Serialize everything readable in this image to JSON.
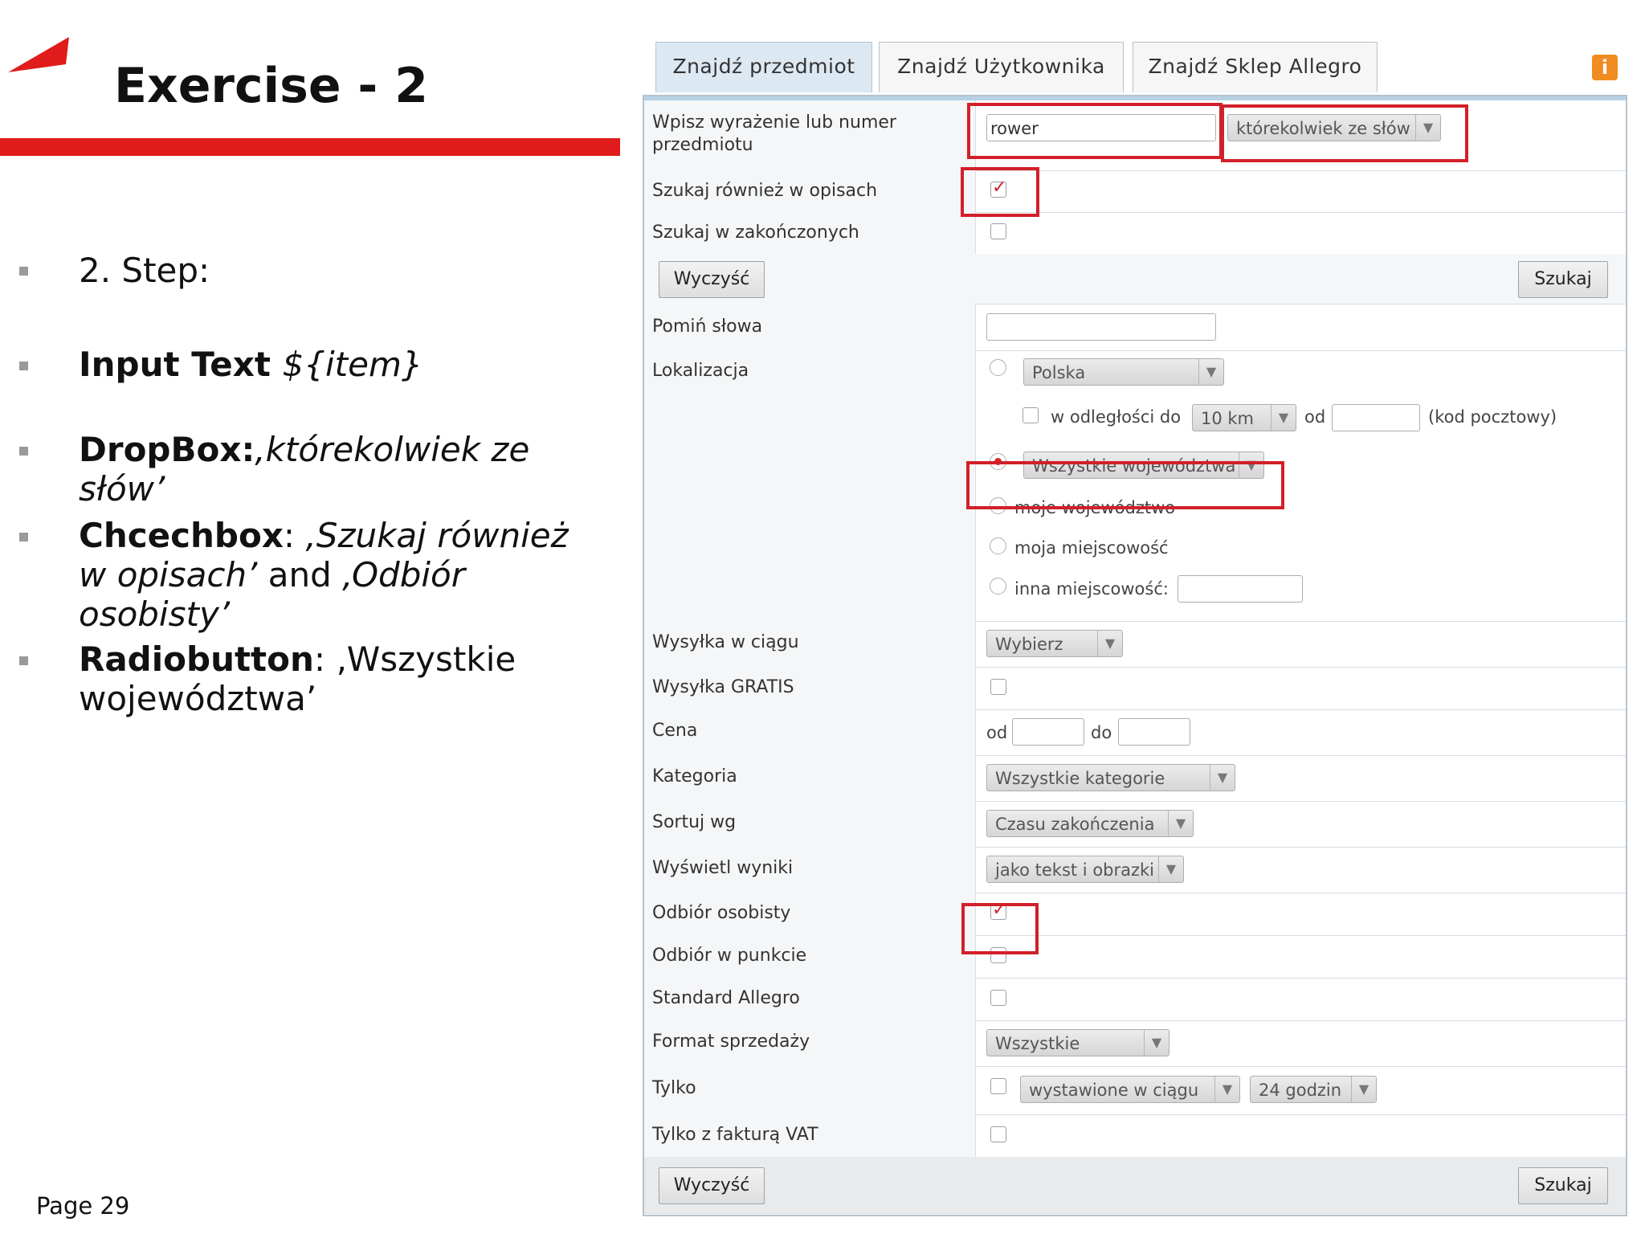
{
  "slide": {
    "title": "Exercise - 2",
    "page": "Page 29",
    "bullets": {
      "step": "2. Step:",
      "input_bold": "Input Text ",
      "input_italic": "${item}",
      "dropbox_bold": "DropBox:",
      "dropbox_italic": "‚którekolwiek ze słów’",
      "check_bold": "Chcechbox",
      "check_colon": ": ",
      "check_italic1": "‚Szukaj również",
      "check_italic2": "w opisach’",
      "check_and": " and ",
      "check_italic3": "‚Odbiór osobisty’",
      "radio_bold": "Radiobutton",
      "radio_rest1": ": ‚Wszystkie",
      "radio_rest2": "województwa’"
    },
    "colors": {
      "accent": "#e01b1b"
    }
  },
  "form": {
    "tabs": [
      "Znajdź przedmiot",
      "Znajdź Użytkownika",
      "Znajdź Sklep Allegro"
    ],
    "info_icon": "i",
    "labels": {
      "query_line1": "Wpisz wyrażenie lub numer",
      "query_line2": "przedmiotu",
      "in_desc": "Szukaj również w opisach",
      "in_ended": "Szukaj w zakończonych",
      "skip_words": "Pomiń słowa",
      "location": "Lokalizacja",
      "shipping_within": "Wysyłka w ciągu",
      "free_shipping": "Wysyłka GRATIS",
      "price": "Cena",
      "category": "Kategoria",
      "sort_by": "Sortuj wg",
      "display": "Wyświetl wyniki",
      "personal_pickup": "Odbiór osobisty",
      "point_pickup": "Odbiór w punkcie",
      "standard": "Standard Allegro",
      "sale_format": "Format sprzedaży",
      "only": "Tylko",
      "vat": "Tylko z fakturą VAT"
    },
    "values": {
      "query": "rower",
      "match_mode": "którekolwiek ze słów",
      "country": "Polska",
      "distance_label": "w odległości do",
      "distance": "10 km",
      "from_label": "od",
      "postal_hint": "(kod pocztowy)",
      "region": "Wszystkie województwa",
      "my_region": "moje województwo",
      "my_town": "moja miejscowość",
      "other_town": "inna miejscowość:",
      "shipping_select": "Wybierz",
      "price_from": "od",
      "price_to": "do",
      "category_select": "Wszystkie kategorie",
      "sort_select": "Czasu zakończenia",
      "display_select": "jako tekst i obrazki",
      "format_select": "Wszystkie",
      "listed_within": "wystawione w ciągu",
      "hours": "24 godzin",
      "arrow": "▼"
    },
    "buttons": {
      "clear": "Wyczyść",
      "search": "Szukaj"
    },
    "state": {
      "in_desc_checked": true,
      "personal_pickup_checked": true,
      "region_all_selected": true
    }
  }
}
